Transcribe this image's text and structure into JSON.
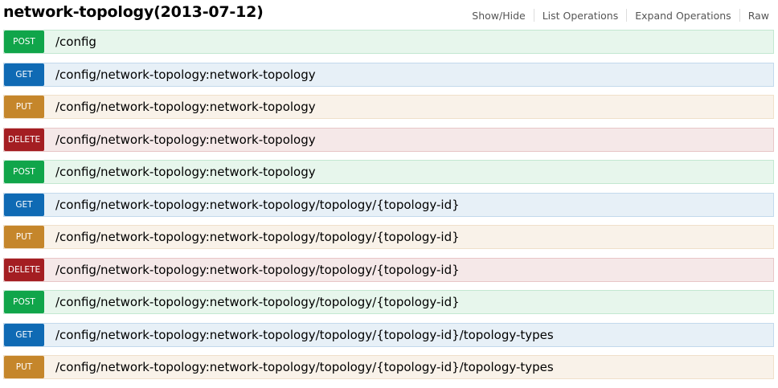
{
  "header": {
    "title": "network-topology(2013-07-12)",
    "nav": [
      "Show/Hide",
      "List Operations",
      "Expand Operations",
      "Raw"
    ]
  },
  "colors": {
    "POST": "#10a54a",
    "GET": "#0f6ab4",
    "PUT": "#c5862b",
    "DELETE": "#a41e22"
  },
  "operations": [
    {
      "method": "POST",
      "path": "/config"
    },
    {
      "method": "GET",
      "path": "/config/network-topology:network-topology"
    },
    {
      "method": "PUT",
      "path": "/config/network-topology:network-topology"
    },
    {
      "method": "DELETE",
      "path": "/config/network-topology:network-topology"
    },
    {
      "method": "POST",
      "path": "/config/network-topology:network-topology"
    },
    {
      "method": "GET",
      "path": "/config/network-topology:network-topology/topology/{topology-id}"
    },
    {
      "method": "PUT",
      "path": "/config/network-topology:network-topology/topology/{topology-id}"
    },
    {
      "method": "DELETE",
      "path": "/config/network-topology:network-topology/topology/{topology-id}"
    },
    {
      "method": "POST",
      "path": "/config/network-topology:network-topology/topology/{topology-id}"
    },
    {
      "method": "GET",
      "path": "/config/network-topology:network-topology/topology/{topology-id}/topology-types"
    },
    {
      "method": "PUT",
      "path": "/config/network-topology:network-topology/topology/{topology-id}/topology-types"
    }
  ]
}
